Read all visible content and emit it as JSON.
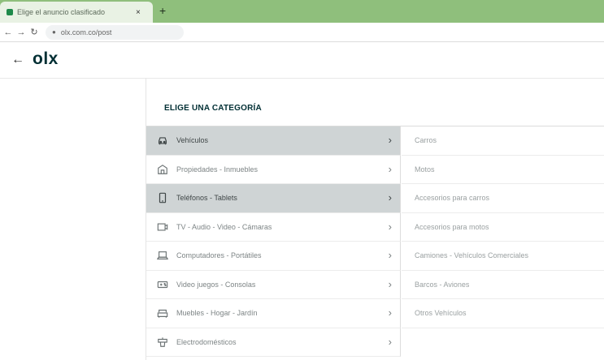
{
  "browser": {
    "tab_title": "Elige el anuncio clasificado",
    "tab_close": "×",
    "new_tab": "+",
    "url": "olx.com.co/post"
  },
  "header": {
    "back": "←",
    "logo": "olx"
  },
  "panel": {
    "title": "ELIGE UNA CATEGORÍA"
  },
  "categories": [
    {
      "label": "Vehículos",
      "icon": "car-icon",
      "active": true
    },
    {
      "label": "Propiedades - Inmuebles",
      "icon": "house-icon",
      "active": false
    },
    {
      "label": "Teléfonos - Tablets",
      "icon": "phone-icon",
      "active": true
    },
    {
      "label": "TV - Audio - Video - Cámaras",
      "icon": "tv-icon",
      "active": false
    },
    {
      "label": "Computadores - Portátiles",
      "icon": "laptop-icon",
      "active": false
    },
    {
      "label": "Video juegos - Consolas",
      "icon": "gamepad-icon",
      "active": false
    },
    {
      "label": "Muebles - Hogar - Jardín",
      "icon": "sofa-icon",
      "active": false
    },
    {
      "label": "Electrodomésticos",
      "icon": "appliance-icon",
      "active": false
    }
  ],
  "subcategories": [
    {
      "label": "Carros"
    },
    {
      "label": "Motos"
    },
    {
      "label": "Accesorios para carros"
    },
    {
      "label": "Accesorios para motos"
    },
    {
      "label": "Camiones - Vehículos Comerciales"
    },
    {
      "label": "Barcos - Aviones"
    },
    {
      "label": "Otros Vehículos"
    }
  ],
  "colors": {
    "tab_strip": "#8fbf7c",
    "active_row": "#cfd4d5",
    "brand": "#002f34"
  }
}
